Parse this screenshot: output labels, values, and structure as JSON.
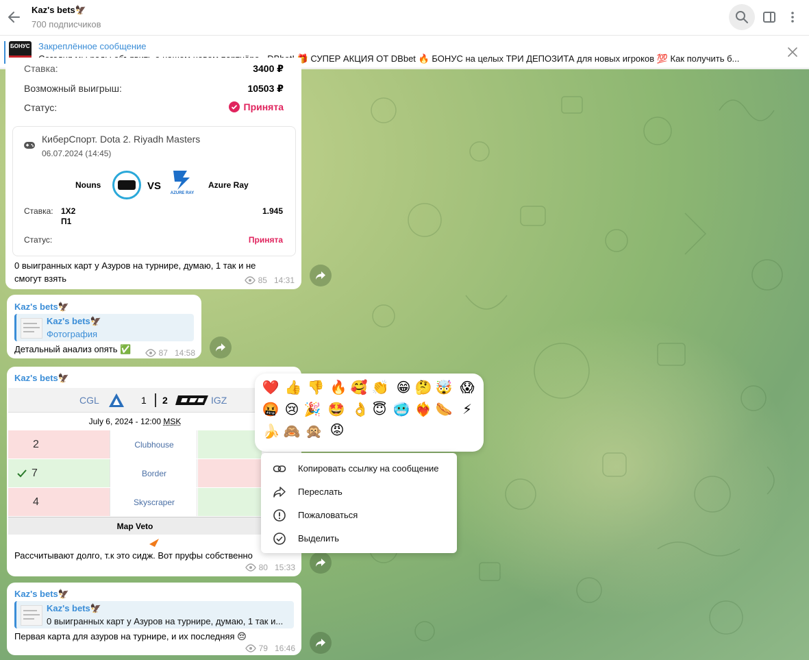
{
  "header": {
    "title": "Kaz's bets🦅",
    "subscribers": "700 подписчиков",
    "icons": [
      "back-arrow-icon",
      "search-icon",
      "sidebar-toggle-icon",
      "more-vertical-icon"
    ]
  },
  "pinned": {
    "label": "Закреплённое сообщение",
    "text": "Сегодня мы рады объявить о нашем новом партнёре - DBbet! 🎁 СУПЕР АКЦИЯ ОТ DBbet 🔥    БОНУС на целых ТРИ ДЕПОЗИТА для новых игроков 💯    Как получить б...",
    "thumb_text": "БОНУС"
  },
  "msg1": {
    "stake_label": "Ставка:",
    "stake_value": "3400 ₽",
    "win_label": "Возможный выигрыш:",
    "win_value": "10503 ₽",
    "status_label": "Статус:",
    "status_value": "Принята",
    "event": "КиберСпорт. Dota 2. Riyadh Masters",
    "date": "06.07.2024 (14:45)",
    "team1": "Nouns",
    "vs": "VS",
    "team2": "Azure Ray",
    "team2_logo_text": "AZURE RAY",
    "bet_label": "Ставка:",
    "bet_line1": "1X2",
    "bet_line2": "П1",
    "odds": "1.945",
    "card_status_label": "Статус:",
    "card_status_value": "Принята",
    "caption": "0 выигранных карт у Азуров на турнире, думаю, 1 так и не смогут взять",
    "views": "85",
    "time": "14:31"
  },
  "msg2": {
    "author": "Kaz's bets🦅",
    "quote_author": "Kaz's bets🦅",
    "quote_text": "Фотография",
    "text": "Детальный анализ опять ✅",
    "views": "87",
    "time": "14:58"
  },
  "msg3": {
    "author": "Kaz's bets🦅",
    "team1": "CGL",
    "score1": "1",
    "score2": "2",
    "team2": "IGZ",
    "datetime": "July 6, 2024 - 12:00",
    "tz": "MSK",
    "maps": [
      {
        "left": "2",
        "name": "Clubhouse",
        "win": false
      },
      {
        "left": "7",
        "name": "Border",
        "win": true
      },
      {
        "left": "4",
        "name": "Skyscraper",
        "win": false
      }
    ],
    "veto_label": "Map Veto",
    "text": "Рассчитывают долго, т.к это сидж. Вот пруфы собственно",
    "views": "80",
    "time": "15:33"
  },
  "msg4": {
    "author": "Kaz's bets🦅",
    "quote_author": "Kaz's bets🦅",
    "quote_text": "0 выигранных карт у Азуров на турнире, думаю, 1 так и...",
    "text": "Первая карта для азуров на турнире, и их последняя 😔",
    "views": "79",
    "time": "16:46"
  },
  "reactions": [
    "❤️",
    "👍",
    "👎",
    "🔥",
    "🥰",
    "👏",
    "😁",
    "🤔",
    "🤯",
    "😱",
    "🤬",
    "😢",
    "🎉",
    "🤩",
    "👌",
    "😇",
    "🥶",
    "❤‍🔥",
    "🌭",
    "⚡",
    "🍌",
    "🙈",
    "🙊",
    "😡"
  ],
  "context_menu": {
    "items": [
      "Копировать ссылку на сообщение",
      "Переслать",
      "Пожаловаться",
      "Выделить"
    ]
  }
}
